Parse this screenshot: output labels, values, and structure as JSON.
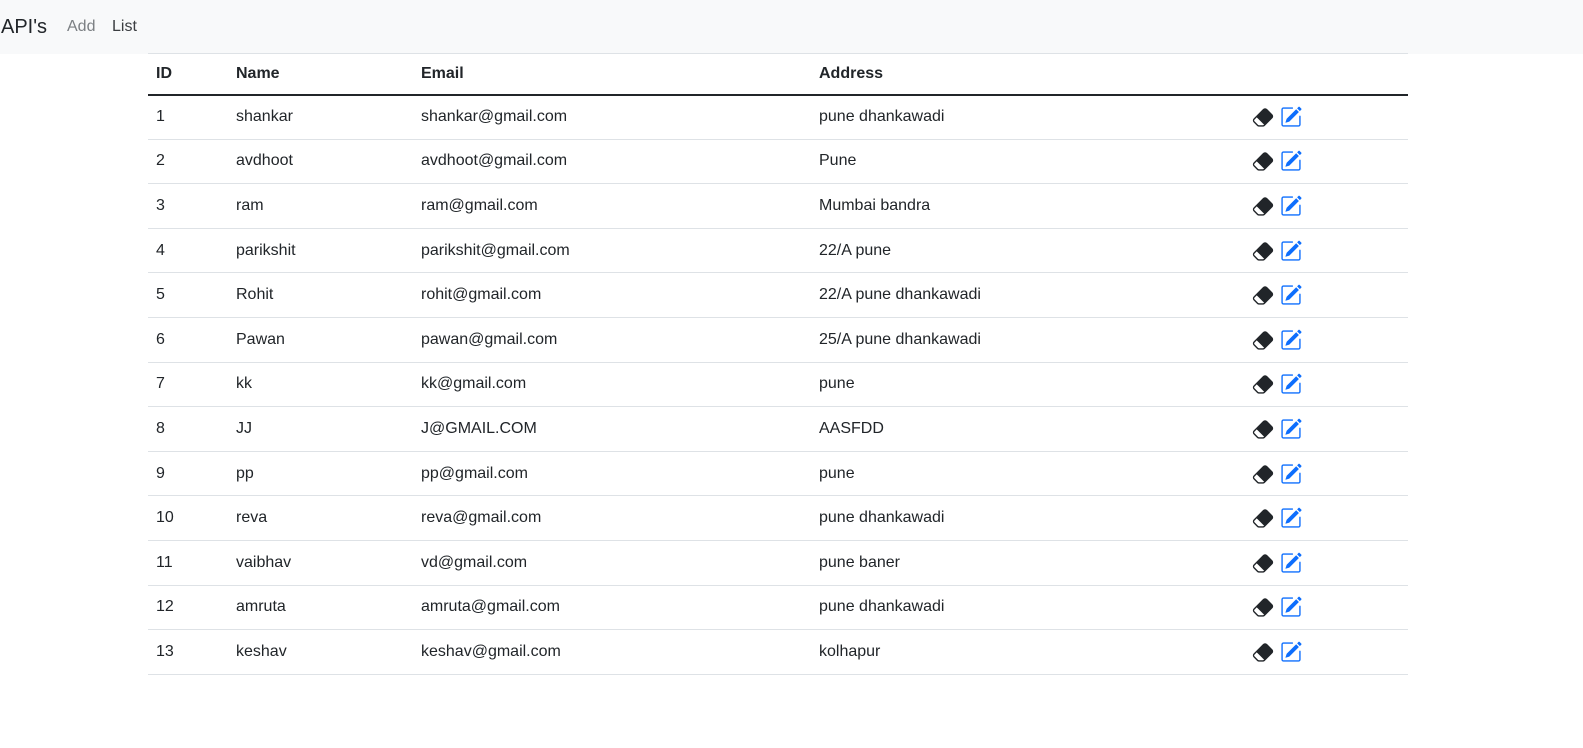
{
  "navbar": {
    "brand": "API's",
    "links": [
      "Add",
      "List"
    ]
  },
  "table": {
    "headers": [
      "ID",
      "Name",
      "Email",
      "Address",
      ""
    ],
    "rows": [
      [
        "1",
        "shankar",
        "shankar@gmail.com",
        "pune dhankawadi"
      ],
      [
        "2",
        "avdhoot",
        "avdhoot@gmail.com",
        "Pune"
      ],
      [
        "3",
        "ram",
        "ram@gmail.com",
        "Mumbai bandra"
      ],
      [
        "4",
        "parikshit",
        "parikshit@gmail.com",
        "22/A pune"
      ],
      [
        "5",
        "Rohit",
        "rohit@gmail.com",
        "22/A pune dhankawadi"
      ],
      [
        "6",
        "Pawan",
        "pawan@gmail.com",
        "25/A pune dhankawadi"
      ],
      [
        "7",
        "kk",
        "kk@gmail.com",
        "pune"
      ],
      [
        "8",
        "JJ",
        "J@GMAIL.COM",
        "AASFDD"
      ],
      [
        "9",
        "pp",
        "pp@gmail.com",
        "pune"
      ],
      [
        "10",
        "reva",
        "reva@gmail.com",
        "pune dhankawadi"
      ],
      [
        "11",
        "vaibhav",
        "vd@gmail.com",
        "pune baner"
      ],
      [
        "12",
        "amruta",
        "amruta@gmail.com",
        "pune dhankawadi"
      ],
      [
        "13",
        "keshav",
        "keshav@gmail.com",
        "kolhapur"
      ]
    ],
    "row_actions": [
      {
        "icon": "eraser-icon",
        "color": "#212529"
      },
      {
        "icon": "edit-icon",
        "color": "#0d6efd"
      }
    ]
  }
}
